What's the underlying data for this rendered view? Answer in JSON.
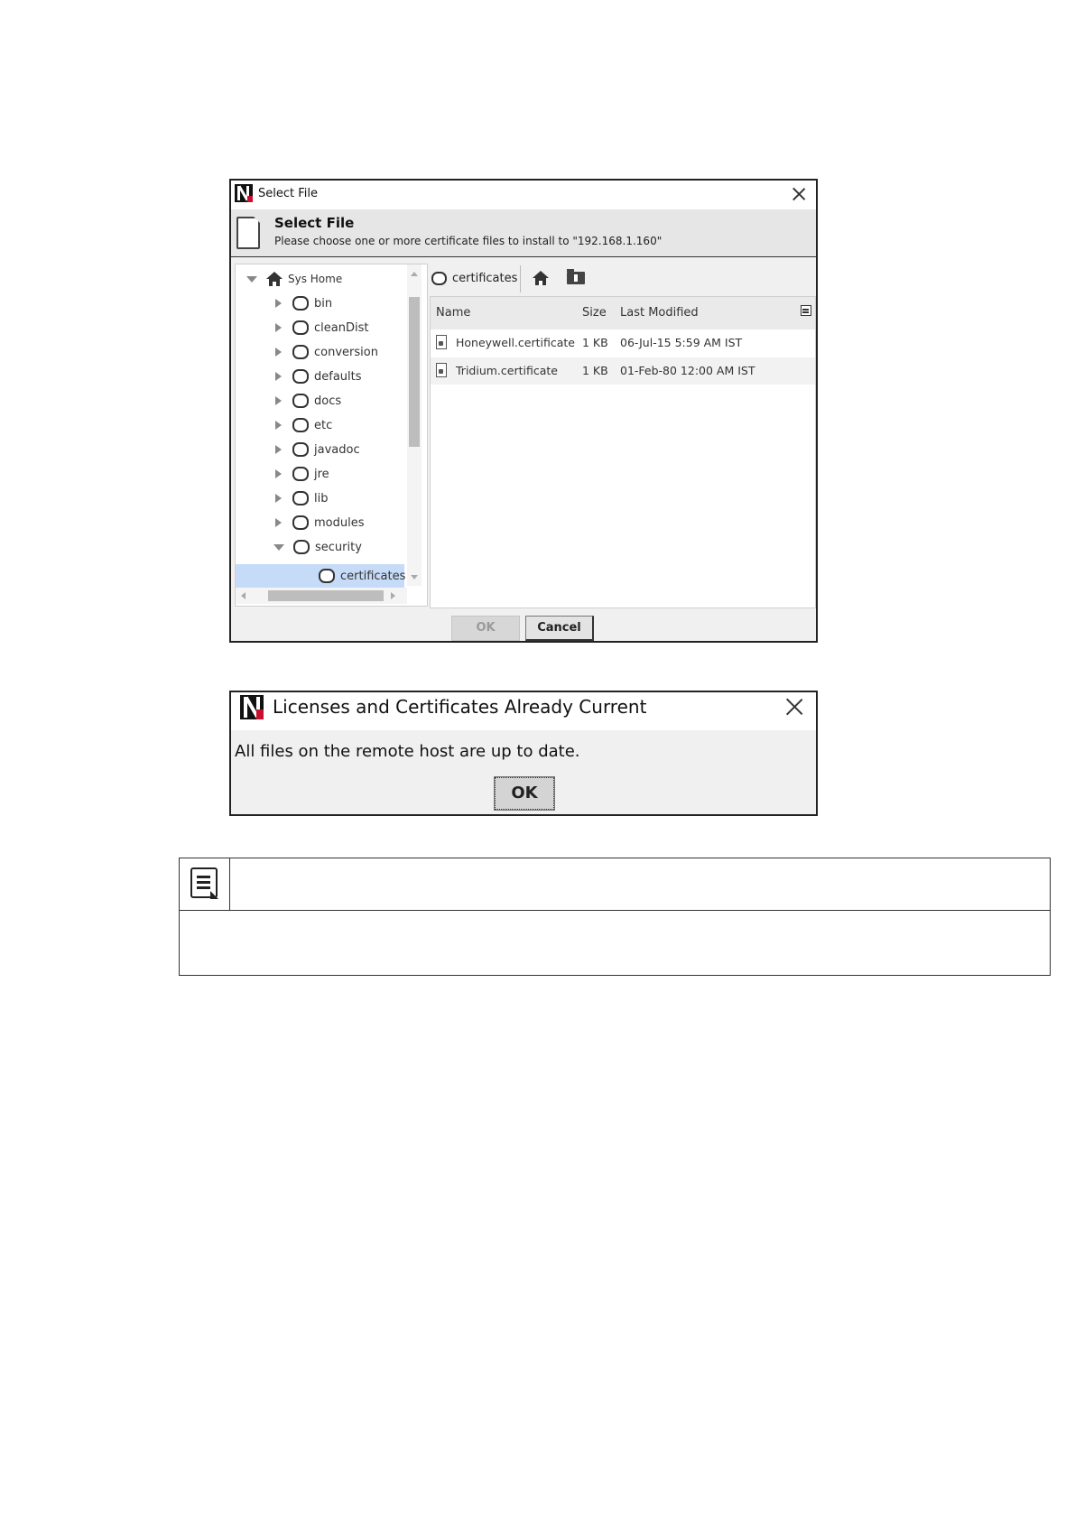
{
  "select_file_dialog": {
    "window_title": "Select File",
    "header_title": "Select File",
    "header_subtitle": "Please choose one or more certificate files to install to \"192.168.1.160\"",
    "tree": {
      "root": "Sys Home",
      "items": [
        {
          "label": "bin",
          "expanded": false
        },
        {
          "label": "cleanDist",
          "expanded": false
        },
        {
          "label": "conversion",
          "expanded": false
        },
        {
          "label": "defaults",
          "expanded": false
        },
        {
          "label": "docs",
          "expanded": false
        },
        {
          "label": "etc",
          "expanded": false
        },
        {
          "label": "javadoc",
          "expanded": false
        },
        {
          "label": "jre",
          "expanded": false
        },
        {
          "label": "lib",
          "expanded": false
        },
        {
          "label": "modules",
          "expanded": false
        },
        {
          "label": "security",
          "expanded": true
        }
      ],
      "selected_child": "certificates"
    },
    "path_label": "certificates",
    "columns": {
      "name": "Name",
      "size": "Size",
      "modified": "Last Modified"
    },
    "files": [
      {
        "name": "Honeywell.certificate",
        "size": "1 KB",
        "modified": "06-Jul-15 5:59 AM IST"
      },
      {
        "name": "Tridium.certificate",
        "size": "1 KB",
        "modified": "01-Feb-80 12:00 AM IST"
      }
    ],
    "ok_label": "OK",
    "cancel_label": "Cancel"
  },
  "licenses_dialog": {
    "title": "Licenses and Certificates Already Current",
    "message": "All files on the remote host are up to date.",
    "ok_label": "OK"
  },
  "colors": {
    "selection": "#c6dbf7",
    "logo_red": "#c8102e"
  }
}
